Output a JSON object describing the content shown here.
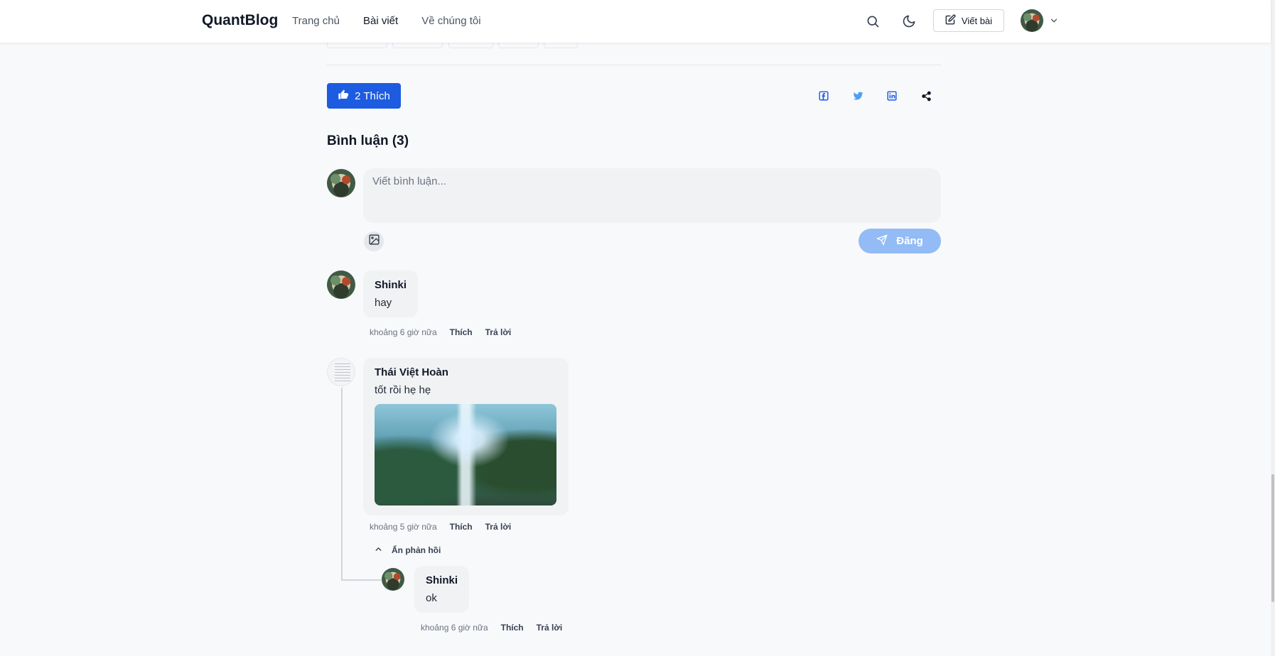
{
  "header": {
    "logo": "QuantBlog",
    "nav": [
      {
        "label": "Trang chủ"
      },
      {
        "label": "Bài viết"
      },
      {
        "label": "Về chúng tôi"
      }
    ],
    "write_label": "Viết bài",
    "icons": [
      "search-icon",
      "moon-icon",
      "edit-icon",
      "chevron-down-icon"
    ]
  },
  "post_actions": {
    "like_label": "2 Thích",
    "share_icons": [
      "facebook-icon",
      "twitter-icon",
      "linkedin-icon",
      "share-icon"
    ]
  },
  "comments": {
    "title": "Bình luận (3)",
    "input_placeholder": "Viết bình luận...",
    "post_label": "Đăng",
    "items": [
      {
        "author": "Shinki",
        "text": "hay",
        "time": "khoảng 6 giờ nữa",
        "like_label": "Thích",
        "reply_label": "Trả lời"
      },
      {
        "author": "Thái Việt Hoàn",
        "text": "tốt rồi hẹ hẹ",
        "time": "khoảng 5 giờ nữa",
        "like_label": "Thích",
        "reply_label": "Trả lời",
        "hide_replies_label": "Ẩn phản hồi",
        "replies": [
          {
            "author": "Shinki",
            "text": "ok",
            "time": "khoảng 6 giờ nữa",
            "like_label": "Thích",
            "reply_label": "Trả lời"
          }
        ]
      }
    ]
  },
  "colors": {
    "primary": "#1d5be0",
    "post_button_disabled": "#93bbf5",
    "facebook": "#1d5be0",
    "twitter": "#4a9ff5",
    "linkedin": "#1d5be0"
  }
}
